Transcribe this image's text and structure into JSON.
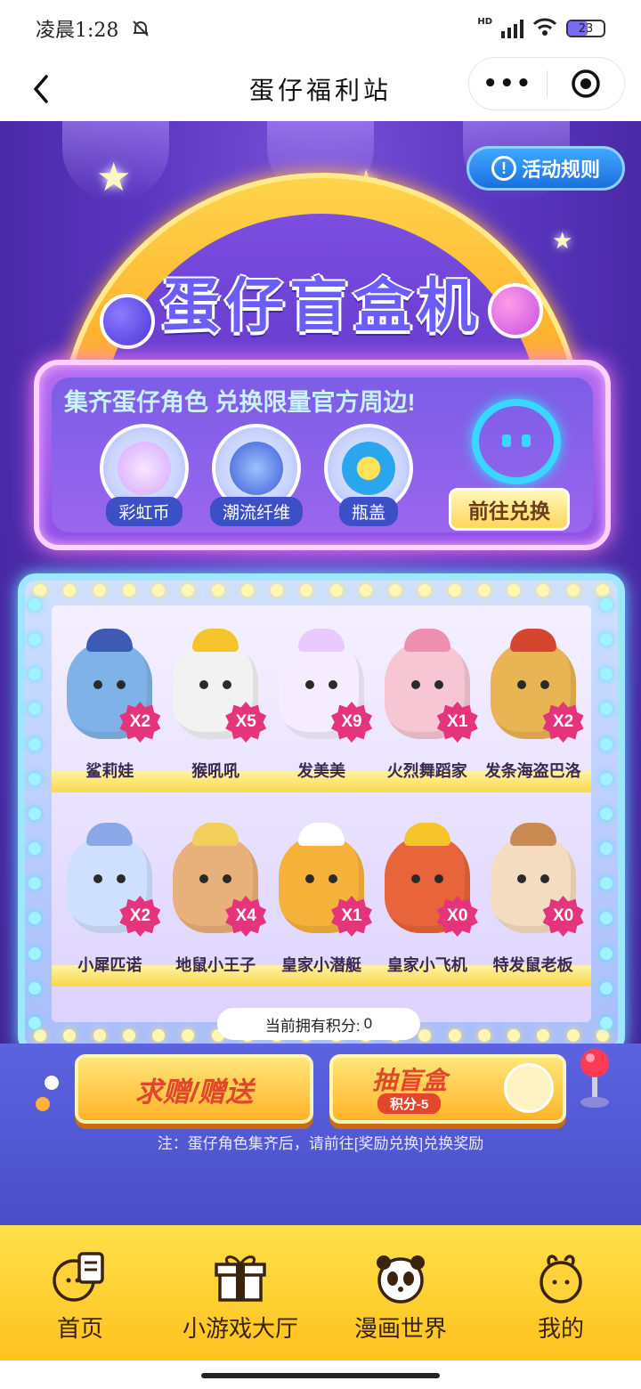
{
  "status_bar": {
    "time": "凌晨1:28",
    "battery": "23"
  },
  "nav": {
    "title": "蛋仔福利站",
    "more_label": "•••"
  },
  "banner": {
    "title": "蛋仔盲盒机",
    "rules_button": "活动规则"
  },
  "info": {
    "heading": "集齐蛋仔角色 兑换限量官方周边!",
    "currencies": [
      {
        "label": "彩虹币",
        "color": "#e7b8ff"
      },
      {
        "label": "潮流纤维",
        "color": "#5c84e8"
      },
      {
        "label": "瓶盖",
        "color": "#39b4f0"
      }
    ],
    "exchange_button": "前往兑换"
  },
  "figures_row1": [
    {
      "name": "鲨莉娃",
      "count": "X2",
      "color": "#7fb2e8"
    },
    {
      "name": "猴吼吼",
      "count": "X5",
      "color": "#f2f2f2"
    },
    {
      "name": "发美美",
      "count": "X9",
      "color": "#f5ecff"
    },
    {
      "name": "火烈舞蹈家",
      "count": "X1",
      "color": "#f7c6d4"
    },
    {
      "name": "发条海盗巴洛",
      "count": "X2",
      "color": "#e9b453"
    }
  ],
  "figures_row2": [
    {
      "name": "小犀匹诺",
      "count": "X2",
      "color": "#cfe0ff"
    },
    {
      "name": "地鼠小王子",
      "count": "X4",
      "color": "#e8b07a"
    },
    {
      "name": "皇家小潜艇",
      "count": "X1",
      "color": "#f5b23a"
    },
    {
      "name": "皇家小飞机",
      "count": "X0",
      "color": "#e8643a"
    },
    {
      "name": "特发鼠老板",
      "count": "X0",
      "color": "#f3dcc0"
    }
  ],
  "points": {
    "label": "当前拥有积分:",
    "value": "0"
  },
  "actions": {
    "gift_button": "求赠/赠送",
    "draw_button": "抽盲盒",
    "draw_cost": "积分-5"
  },
  "note": "注：蛋仔角色集齐后，请前往[奖励兑换]兑换奖励",
  "tabs": [
    {
      "label": "首页"
    },
    {
      "label": "小游戏大厅"
    },
    {
      "label": "漫画世界"
    },
    {
      "label": "我的"
    }
  ]
}
